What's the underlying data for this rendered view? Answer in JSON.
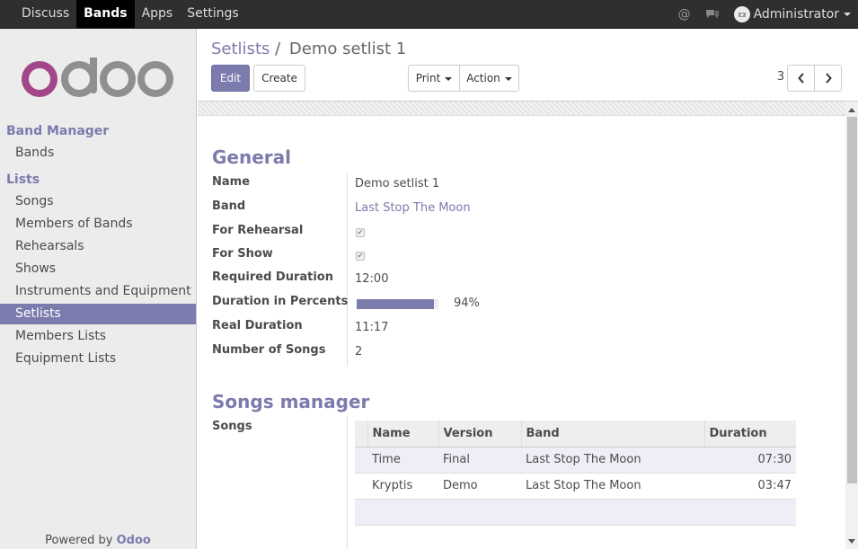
{
  "topbar": {
    "menus": [
      "Discuss",
      "Bands",
      "Apps",
      "Settings"
    ],
    "active_menu": "Bands",
    "user": "Administrator"
  },
  "sidebar": {
    "sections": [
      {
        "title": "Band Manager",
        "items": [
          "Bands"
        ]
      },
      {
        "title": "Lists",
        "items": [
          "Songs",
          "Members of Bands",
          "Rehearsals",
          "Shows",
          "Instruments and Equipment",
          "Setlists",
          "Members Lists",
          "Equipment Lists"
        ]
      }
    ],
    "active_item": "Setlists",
    "powered_prefix": "Powered by",
    "powered_brand": "Odoo"
  },
  "control_panel": {
    "breadcrumb_parent": "Setlists",
    "breadcrumb_sep": "/",
    "breadcrumb_current": "Demo setlist 1",
    "edit_label": "Edit",
    "create_label": "Create",
    "print_label": "Print",
    "action_label": "Action",
    "pager": "3 / 3"
  },
  "form": {
    "general_title": "General",
    "fields": {
      "name_label": "Name",
      "name_value": "Demo setlist 1",
      "band_label": "Band",
      "band_value": "Last Stop The Moon",
      "rehearsal_label": "For Rehearsal",
      "rehearsal_checked": true,
      "show_label": "For Show",
      "show_checked": true,
      "required_label": "Required Duration",
      "required_value": "12:00",
      "percent_label": "Duration in Percents",
      "percent_value": "94%",
      "percent_fraction": 0.94,
      "real_label": "Real Duration",
      "real_value": "11:17",
      "count_label": "Number of Songs",
      "count_value": "2"
    },
    "songs_title": "Songs manager",
    "songs_label": "Songs",
    "songs_table": {
      "headers": [
        "Name",
        "Version",
        "Band",
        "Duration"
      ],
      "rows": [
        {
          "name": "Time",
          "version": "Final",
          "band": "Last Stop The Moon",
          "duration": "07:30"
        },
        {
          "name": "Kryptis",
          "version": "Demo",
          "band": "Last Stop The Moon",
          "duration": "03:47"
        }
      ]
    }
  },
  "colors": {
    "brand": "#7c7bad",
    "logo_o": "#a24689",
    "logo_doo": "#8f8f8f",
    "navbar": "#2f2f2f"
  }
}
